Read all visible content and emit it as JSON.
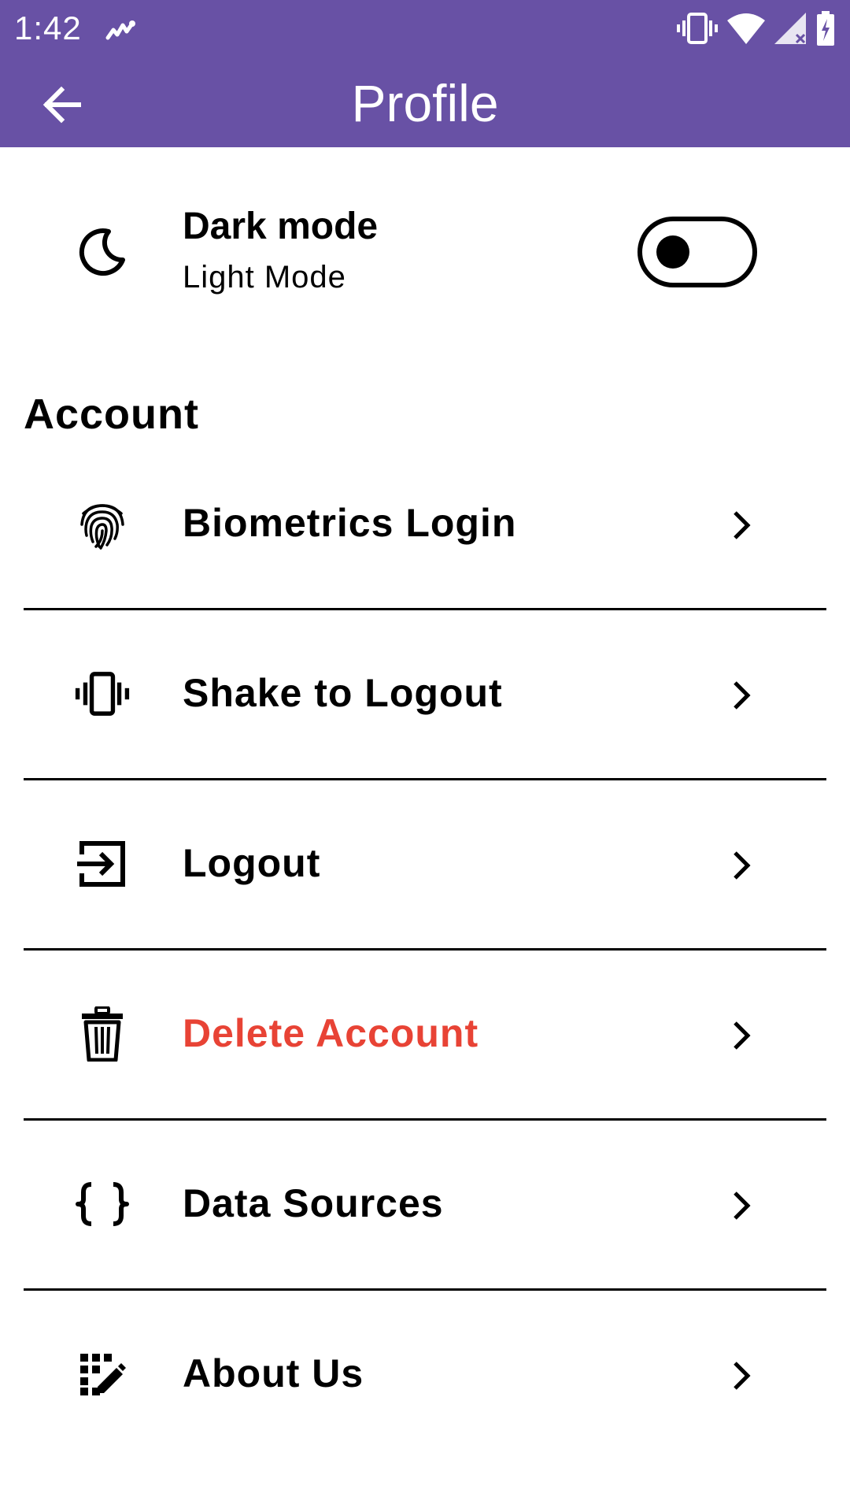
{
  "status_bar": {
    "time": "1:42",
    "icons": [
      "activity-icon",
      "vibrate-icon",
      "wifi-icon",
      "signal-icon",
      "battery-charging-icon"
    ]
  },
  "app_bar": {
    "title": "Profile",
    "back_icon": "arrow-back-icon",
    "background_color": "#6851a5"
  },
  "dark_mode": {
    "title": "Dark mode",
    "subtitle": "Light Mode",
    "icon": "moon-icon",
    "enabled": false
  },
  "account": {
    "section_title": "Account",
    "items": [
      {
        "label": "Biometrics Login",
        "icon": "fingerprint-icon"
      },
      {
        "label": "Shake to Logout",
        "icon": "vibrate-icon"
      },
      {
        "label": "Logout",
        "icon": "logout-icon"
      },
      {
        "label": "Delete Account",
        "icon": "trash-icon",
        "color": "#e84335"
      },
      {
        "label": "Data Sources",
        "icon": "braces-icon"
      },
      {
        "label": "About Us",
        "icon": "draw-icon"
      }
    ]
  }
}
